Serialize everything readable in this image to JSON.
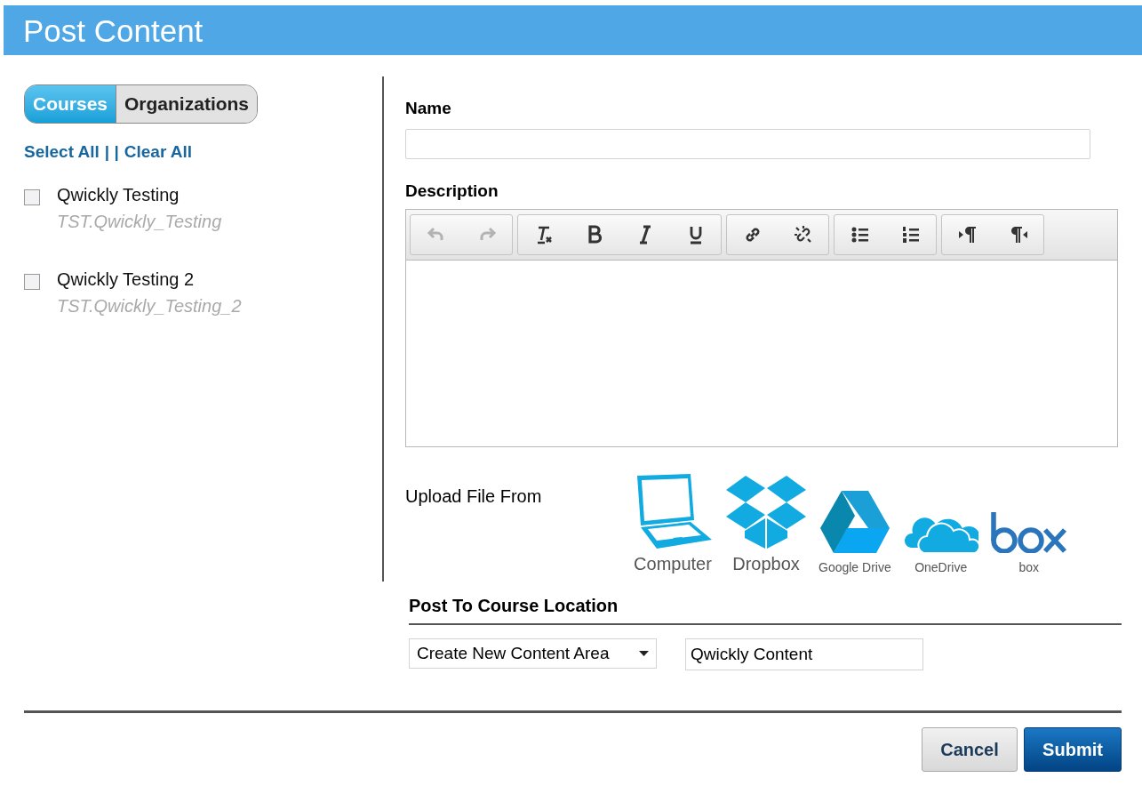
{
  "window": {
    "title": "Post Content"
  },
  "tabs": [
    {
      "label": "Courses",
      "selected": true
    },
    {
      "label": "Organizations",
      "selected": false
    }
  ],
  "select_links": {
    "select_all": "Select All",
    "separator": "| |",
    "clear_all": "Clear All"
  },
  "courses": [
    {
      "name": "Qwickly Testing",
      "id": "TST.Qwickly_Testing",
      "checked": false
    },
    {
      "name": "Qwickly Testing 2",
      "id": "TST.Qwickly_Testing_2",
      "checked": false
    }
  ],
  "name_field": {
    "label": "Name"
  },
  "description": {
    "label": "Description",
    "toolbar": [
      [
        {
          "kind": "undo",
          "disabled": true
        },
        {
          "kind": "redo",
          "disabled": true
        }
      ],
      [
        {
          "kind": "clear-format",
          "disabled": false
        },
        {
          "kind": "bold",
          "disabled": false
        },
        {
          "kind": "italic",
          "disabled": false
        },
        {
          "kind": "underline",
          "disabled": false
        }
      ],
      [
        {
          "kind": "link",
          "disabled": false
        },
        {
          "kind": "unlink",
          "disabled": false
        }
      ],
      [
        {
          "kind": "bullets",
          "disabled": false
        },
        {
          "kind": "numbers",
          "disabled": false
        }
      ],
      [
        {
          "kind": "ltr",
          "disabled": false
        },
        {
          "kind": "rtl",
          "disabled": false
        }
      ]
    ]
  },
  "upload": {
    "label": "Upload File From",
    "sources": [
      {
        "kind": "computer",
        "label": "Computer"
      },
      {
        "kind": "dropbox",
        "label": "Dropbox"
      },
      {
        "kind": "drive",
        "label": "Google Drive"
      },
      {
        "kind": "onedrive",
        "label": "OneDrive"
      },
      {
        "kind": "box",
        "label": "box"
      }
    ]
  },
  "location": {
    "heading": "Post To Course Location",
    "dropdown": "Create New Content Area",
    "value": "Qwickly Content"
  },
  "buttons": {
    "cancel": "Cancel",
    "submit": "Submit"
  }
}
